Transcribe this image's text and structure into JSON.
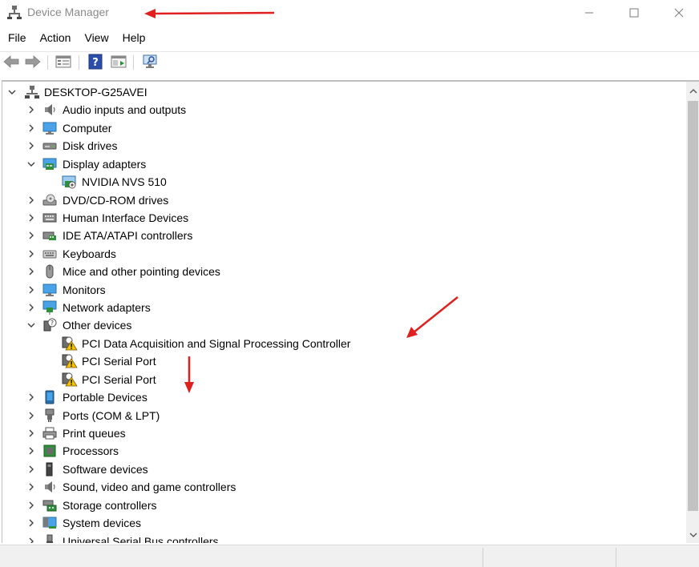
{
  "window": {
    "title": "Device Manager",
    "icons": {
      "app": "device-manager-icon",
      "minimize": "minimize-icon",
      "maximize": "maximize-icon",
      "close": "close-icon"
    }
  },
  "menu": [
    "File",
    "Action",
    "View",
    "Help"
  ],
  "toolbar": {
    "buttons": [
      "back-arrow-icon",
      "forward-arrow-icon",
      "properties-icon",
      "help-icon",
      "show-hidden-icon",
      "scan-hardware-icon"
    ]
  },
  "tree": {
    "root": "DESKTOP-G25AVEI",
    "items": [
      {
        "label": "Audio inputs and outputs",
        "icon": "speaker-icon",
        "level": 1,
        "expander": "collapsed"
      },
      {
        "label": "Computer",
        "icon": "monitor-icon",
        "level": 1,
        "expander": "collapsed"
      },
      {
        "label": "Disk drives",
        "icon": "disk-drive-icon",
        "level": 1,
        "expander": "collapsed"
      },
      {
        "label": "Display adapters",
        "icon": "display-adapter-icon",
        "level": 1,
        "expander": "expanded"
      },
      {
        "label": "NVIDIA NVS 510",
        "icon": "display-adapter-device-icon",
        "level": 2,
        "expander": "none"
      },
      {
        "label": "DVD/CD-ROM drives",
        "icon": "optical-drive-icon",
        "level": 1,
        "expander": "collapsed"
      },
      {
        "label": "Human Interface Devices",
        "icon": "hid-icon",
        "level": 1,
        "expander": "collapsed"
      },
      {
        "label": "IDE ATA/ATAPI controllers",
        "icon": "ide-controller-icon",
        "level": 1,
        "expander": "collapsed"
      },
      {
        "label": "Keyboards",
        "icon": "keyboard-icon",
        "level": 1,
        "expander": "collapsed"
      },
      {
        "label": "Mice and other pointing devices",
        "icon": "mouse-icon",
        "level": 1,
        "expander": "collapsed"
      },
      {
        "label": "Monitors",
        "icon": "monitor-icon",
        "level": 1,
        "expander": "collapsed"
      },
      {
        "label": "Network adapters",
        "icon": "network-adapter-icon",
        "level": 1,
        "expander": "collapsed"
      },
      {
        "label": "Other devices",
        "icon": "unknown-device-icon",
        "level": 1,
        "expander": "expanded"
      },
      {
        "label": "PCI Data Acquisition and Signal Processing Controller",
        "icon": "warning-device-icon",
        "level": 2,
        "expander": "none"
      },
      {
        "label": "PCI Serial Port",
        "icon": "warning-device-icon",
        "level": 2,
        "expander": "none"
      },
      {
        "label": "PCI Serial Port",
        "icon": "warning-device-icon",
        "level": 2,
        "expander": "none"
      },
      {
        "label": "Portable Devices",
        "icon": "portable-device-icon",
        "level": 1,
        "expander": "collapsed"
      },
      {
        "label": "Ports (COM & LPT)",
        "icon": "port-icon",
        "level": 1,
        "expander": "collapsed"
      },
      {
        "label": "Print queues",
        "icon": "printer-icon",
        "level": 1,
        "expander": "collapsed"
      },
      {
        "label": "Processors",
        "icon": "processor-icon",
        "level": 1,
        "expander": "collapsed"
      },
      {
        "label": "Software devices",
        "icon": "software-device-icon",
        "level": 1,
        "expander": "collapsed"
      },
      {
        "label": "Sound, video and game controllers",
        "icon": "speaker-icon",
        "level": 1,
        "expander": "collapsed"
      },
      {
        "label": "Storage controllers",
        "icon": "storage-controller-icon",
        "level": 1,
        "expander": "collapsed"
      },
      {
        "label": "System devices",
        "icon": "system-device-icon",
        "level": 1,
        "expander": "collapsed"
      },
      {
        "label": "Universal Serial Bus controllers",
        "icon": "usb-icon",
        "level": 1,
        "expander": "collapsed"
      }
    ]
  },
  "colors": {
    "annotation": "#e01f1f",
    "warning": "#f2c200",
    "scroll_thumb": "#c2c2c2",
    "title_text": "#8a8a8a"
  }
}
